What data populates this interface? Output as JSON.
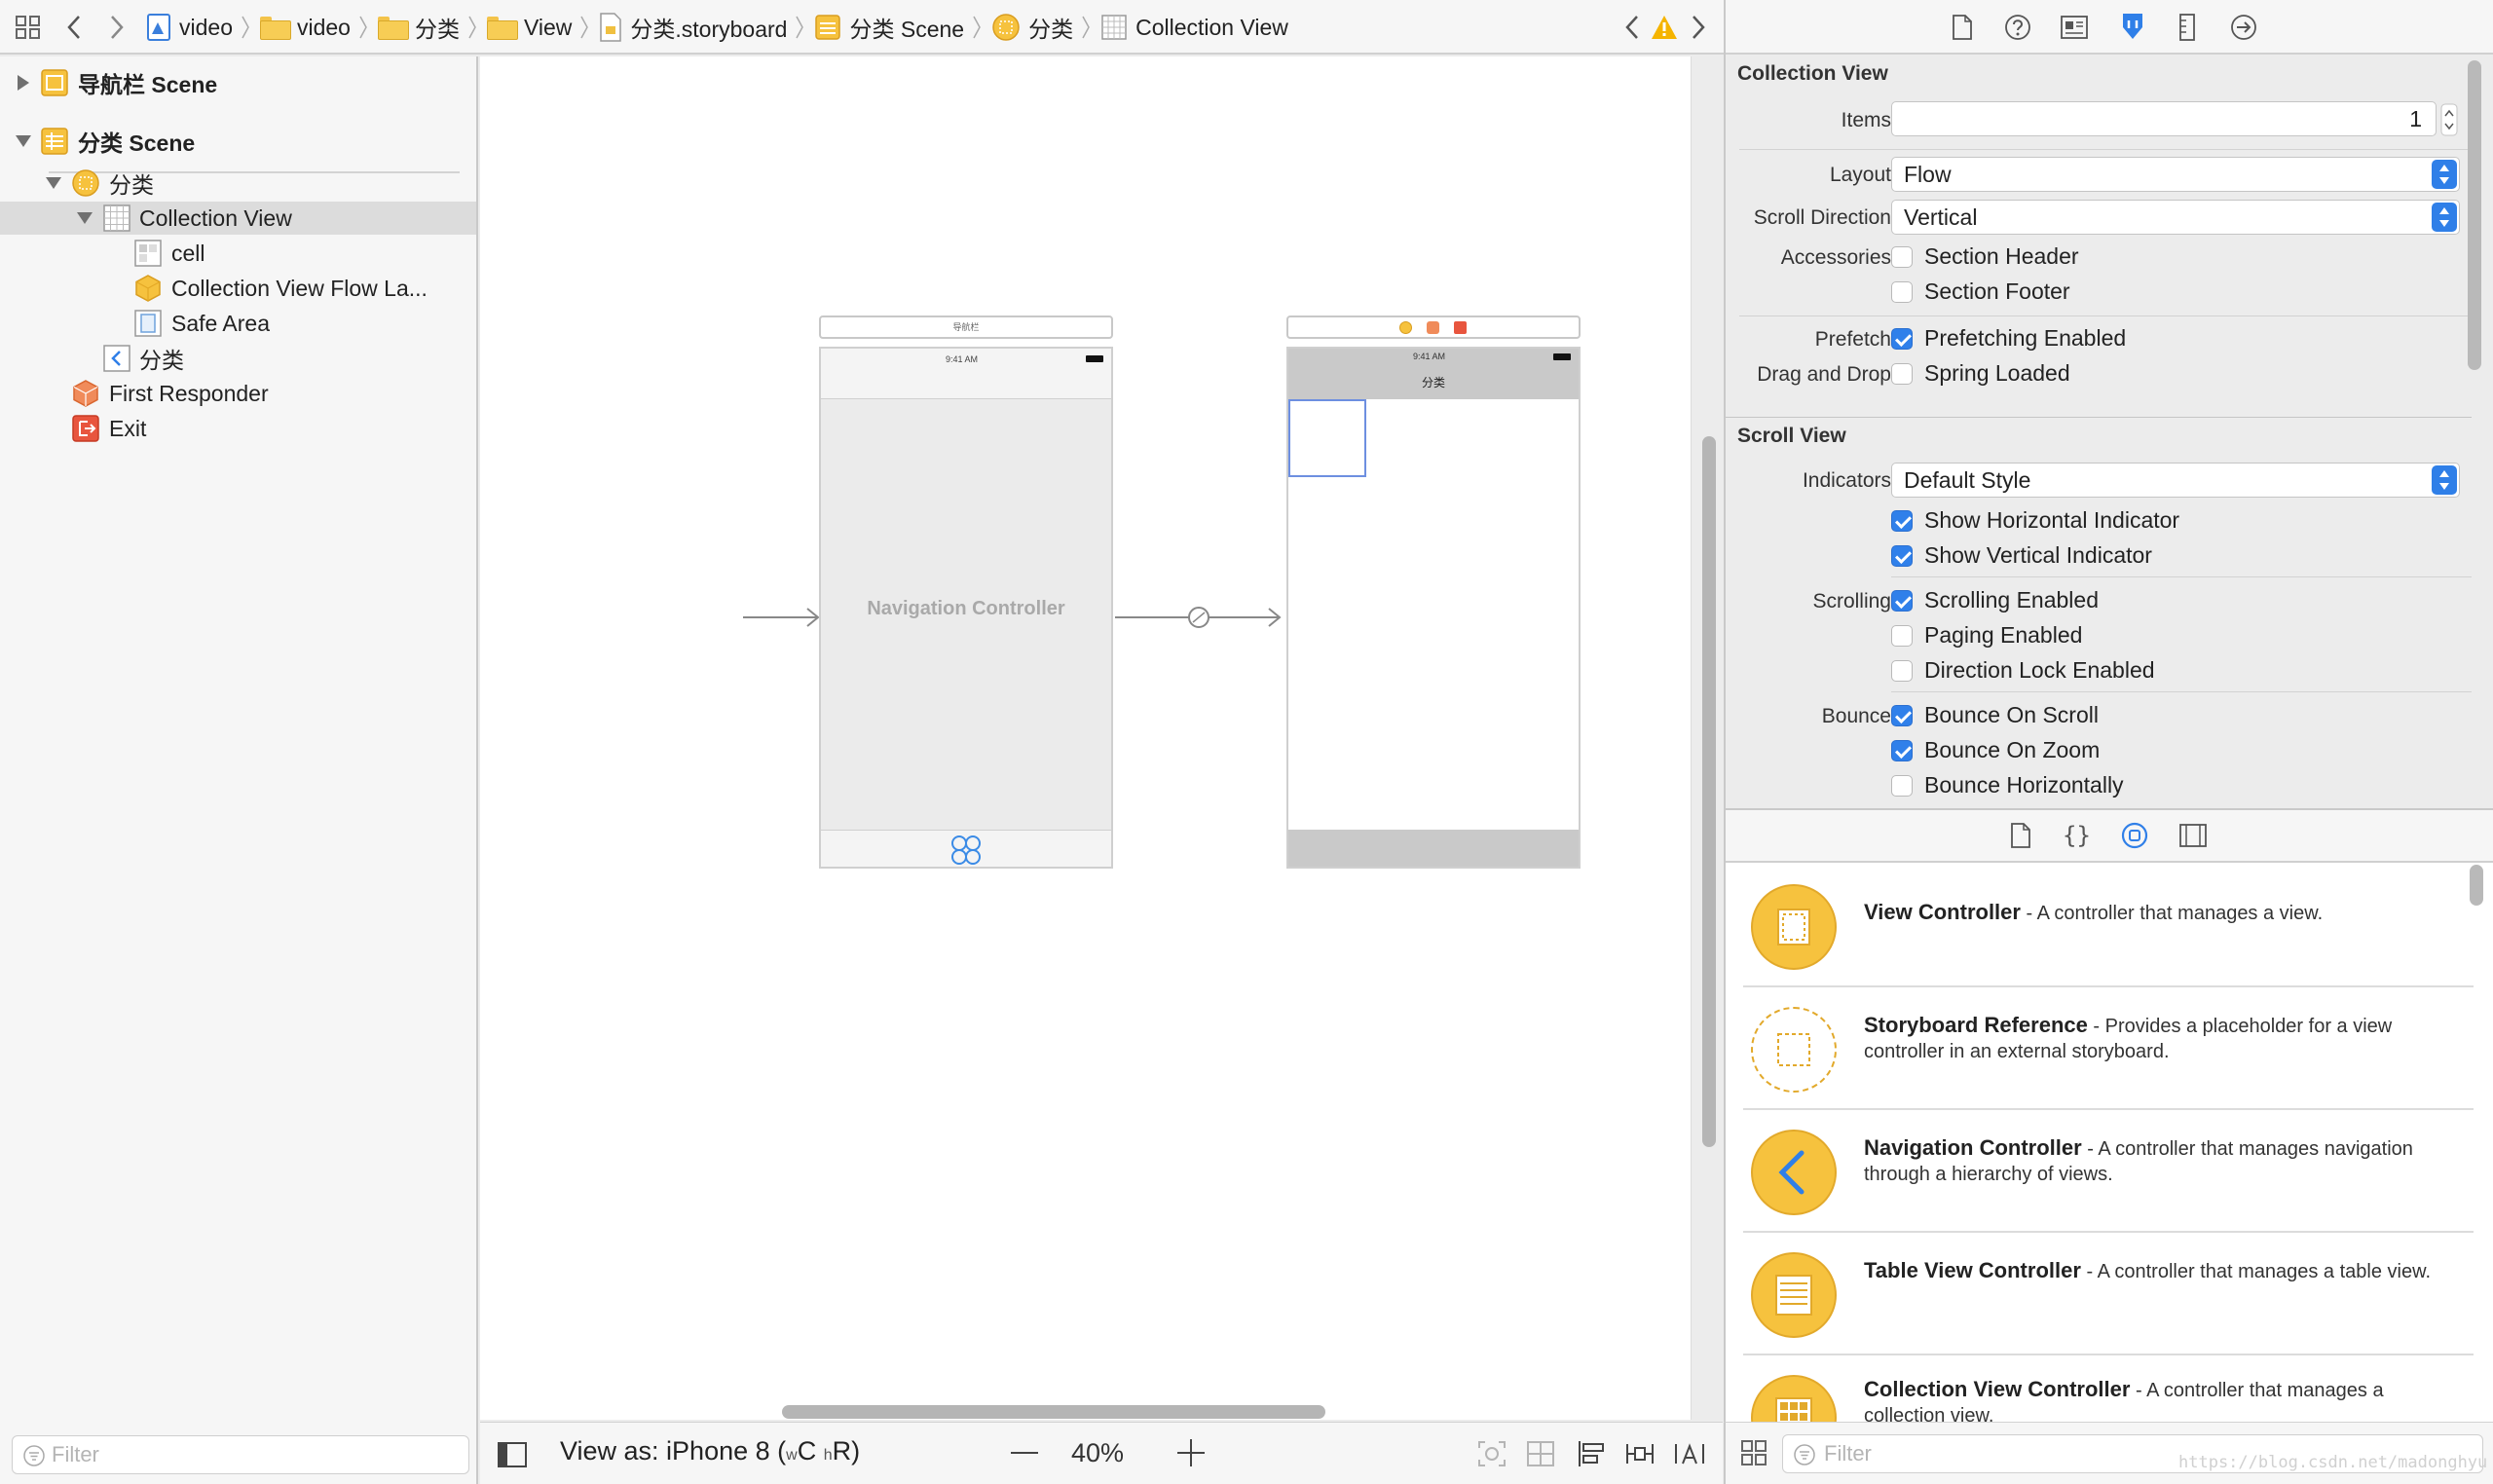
{
  "jumpbar": {
    "crumbs": [
      "video",
      "video",
      "分类",
      "View",
      "分类.storyboard",
      "分类 Scene",
      "分类",
      "Collection View"
    ]
  },
  "navigator": {
    "items": [
      {
        "label": "导航栏 Scene"
      },
      {
        "label": "分类 Scene"
      },
      {
        "label": "分类"
      },
      {
        "label": "Collection View"
      },
      {
        "label": "cell"
      },
      {
        "label": "Collection View Flow La..."
      },
      {
        "label": "Safe Area"
      },
      {
        "label": "分类"
      },
      {
        "label": "First Responder"
      },
      {
        "label": "Exit"
      }
    ],
    "filter_placeholder": "Filter"
  },
  "canvas": {
    "scene1_title": "导航栏",
    "scene1_time": "9:41 AM",
    "scene1_label": "Navigation Controller",
    "scene2_time": "9:41 AM",
    "scene2_nav_title": "分类",
    "view_as": "View as: iPhone 8 (",
    "size_class_w": "w",
    "size_class_w_val": "C",
    "size_class_h": "h",
    "size_class_h_val": "R",
    "size_class_end": ")",
    "zoom": "40%"
  },
  "inspector": {
    "collection_title": "Collection View",
    "items_label": "Items",
    "items_value": "1",
    "layout_label": "Layout",
    "layout_value": "Flow",
    "scroll_direction_label": "Scroll Direction",
    "scroll_direction_value": "Vertical",
    "accessories_label": "Accessories",
    "section_header": "Section Header",
    "section_footer": "Section Footer",
    "prefetch_label": "Prefetch",
    "prefetching_enabled": "Prefetching Enabled",
    "drag_drop_label": "Drag and Drop",
    "spring_loaded": "Spring Loaded",
    "scroll_title": "Scroll View",
    "indicators_label": "Indicators",
    "indicators_value": "Default Style",
    "show_horizontal": "Show Horizontal Indicator",
    "show_vertical": "Show Vertical Indicator",
    "scrolling_label": "Scrolling",
    "scrolling_enabled": "Scrolling Enabled",
    "paging_enabled": "Paging Enabled",
    "direction_lock": "Direction Lock Enabled",
    "bounce_label": "Bounce",
    "bounce_on_scroll": "Bounce On Scroll",
    "bounce_on_zoom": "Bounce On Zoom",
    "bounce_horizontally": "Bounce Horizontally"
  },
  "library": {
    "items": [
      {
        "name": "View Controller",
        "desc": " - A controller that manages a view."
      },
      {
        "name": "Storyboard Reference",
        "desc": " - Provides a placeholder for a view controller in an external storyboard."
      },
      {
        "name": "Navigation Controller",
        "desc": " - A controller that manages navigation through a hierarchy of views."
      },
      {
        "name": "Table View Controller",
        "desc": " - A controller that manages a table view."
      },
      {
        "name": "Collection View Controller",
        "desc": " - A controller that manages a collection view."
      }
    ],
    "filter_placeholder": "Filter",
    "watermark": "https://blog.csdn.net/madonghyu"
  },
  "colors": {
    "accent": "#2f7fe8",
    "folder": "#f7cd55",
    "library_icon": "#f6c23e",
    "warning": "#f5b400"
  }
}
